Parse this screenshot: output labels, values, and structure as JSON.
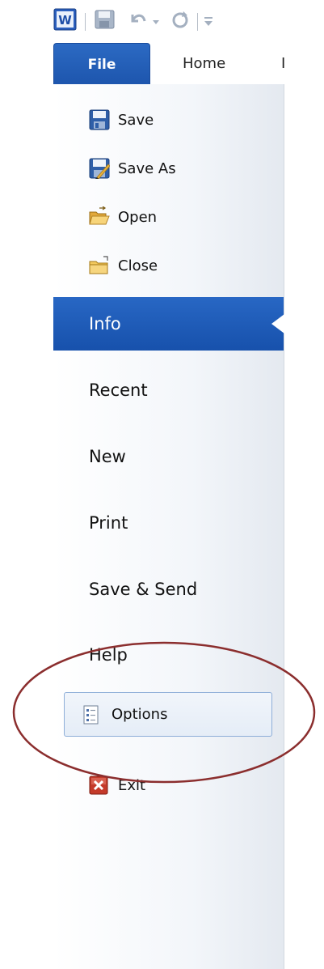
{
  "qat": {
    "icons": [
      "word-logo-icon",
      "save-icon",
      "undo-icon",
      "undo-dropdown-icon",
      "redo-icon",
      "customize-toolbar-icon"
    ]
  },
  "tabs": {
    "file": "File",
    "home": "Home",
    "insert_partial": "I"
  },
  "nav": {
    "commands": [
      {
        "label": "Save",
        "icon": "save-icon"
      },
      {
        "label": "Save As",
        "icon": "save-as-icon"
      },
      {
        "label": "Open",
        "icon": "open-folder-icon"
      },
      {
        "label": "Close",
        "icon": "close-folder-icon"
      }
    ],
    "sections": [
      "Info",
      "Recent",
      "New",
      "Print",
      "Save & Send",
      "Help"
    ],
    "active_section": "Info",
    "options_label": "Options",
    "exit_label": "Exit"
  },
  "colors": {
    "file_tab": "#1d55ad",
    "active_section": "#1751ac",
    "options_border": "#8eaed8",
    "annotation_ring": "#8b2e2e"
  }
}
